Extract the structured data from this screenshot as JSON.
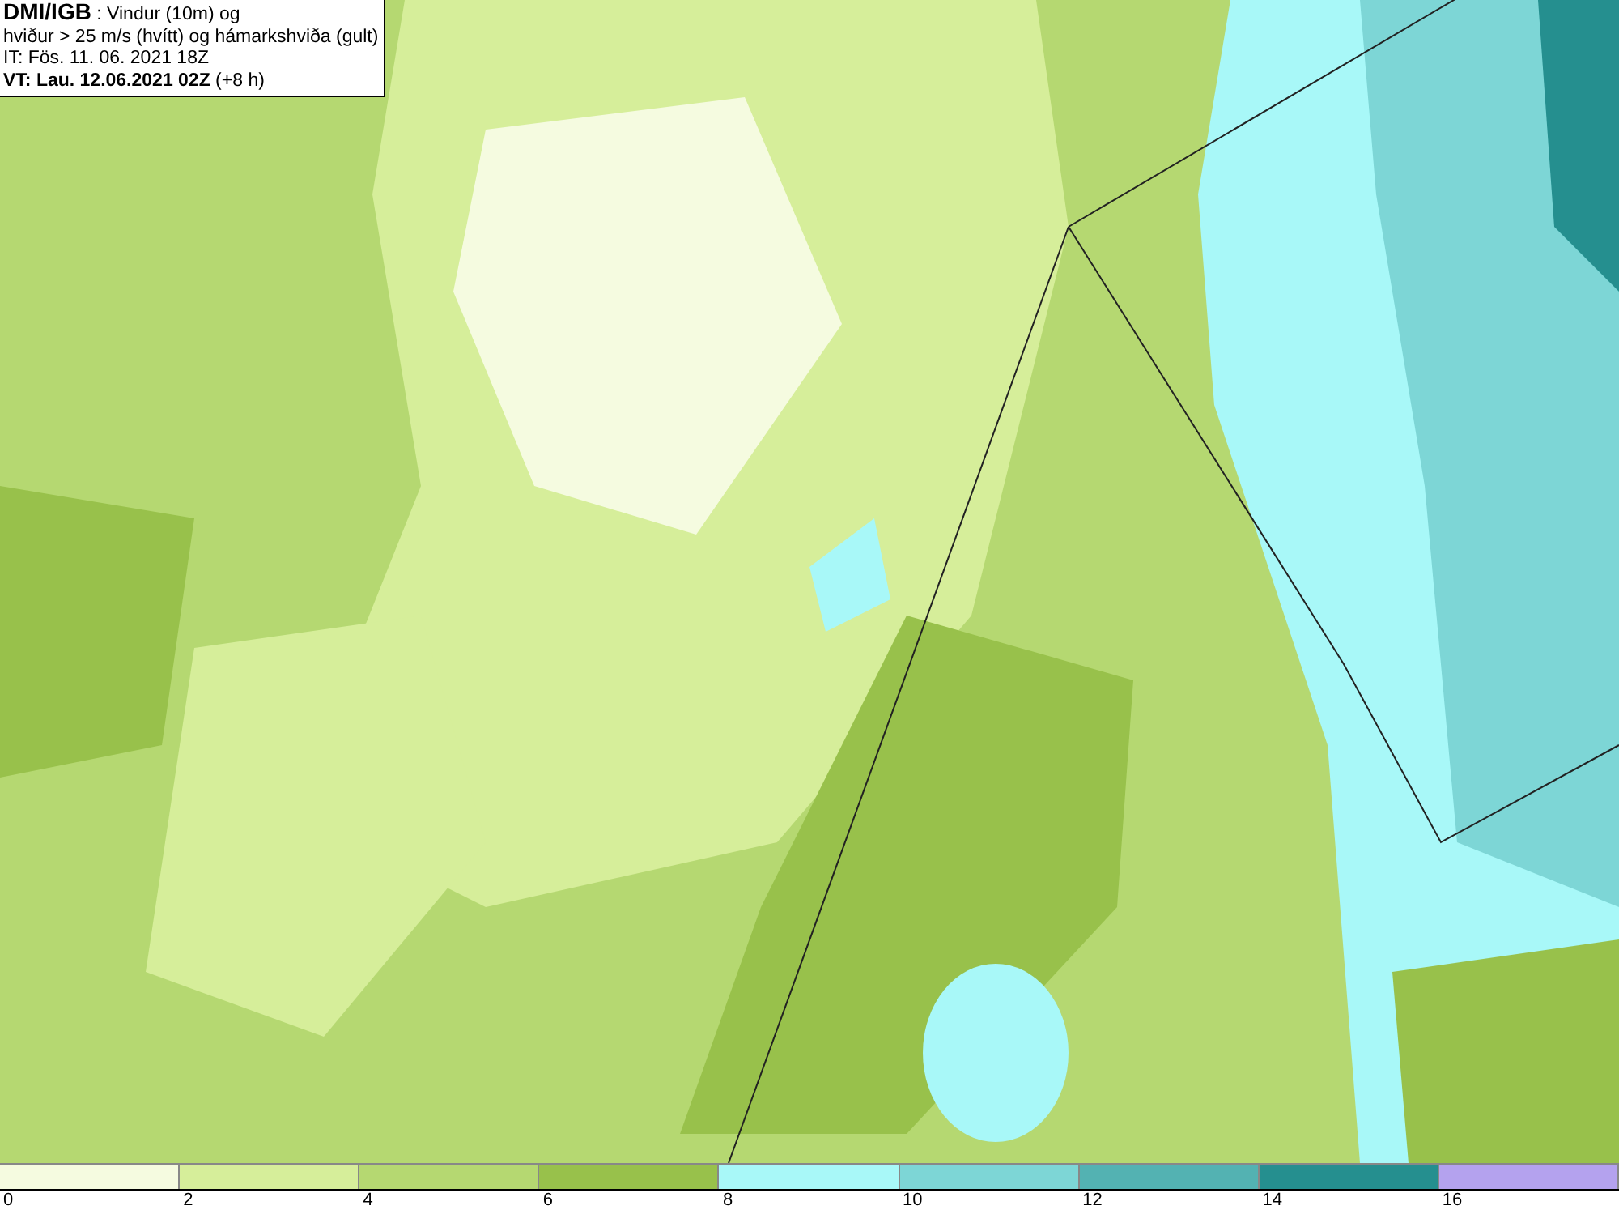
{
  "title_lines": [
    "**DMI/IGB** : Vindur (10m) og",
    "hviður > 25 m/s (hvítt) og hámarkshviða (gult)",
    "IT: Fös. 11. 06. 2021 18Z",
    "**VT: Lau. 12.06.2021 02Z** (+8 h)"
  ],
  "legend": {
    "swatches": [
      {
        "color": "#f5fbe0"
      },
      {
        "color": "#d6ee9a"
      },
      {
        "color": "#b5d871"
      },
      {
        "color": "#98c14b"
      },
      {
        "color": "#a8f8f8"
      },
      {
        "color": "#7dd6d6"
      },
      {
        "color": "#53b2b2"
      },
      {
        "color": "#258f8f"
      },
      {
        "color": "#b4a2ee"
      }
    ],
    "ticks": [
      "0",
      "2",
      "4",
      "6",
      "8",
      "10",
      "12",
      "14",
      "16"
    ]
  }
}
